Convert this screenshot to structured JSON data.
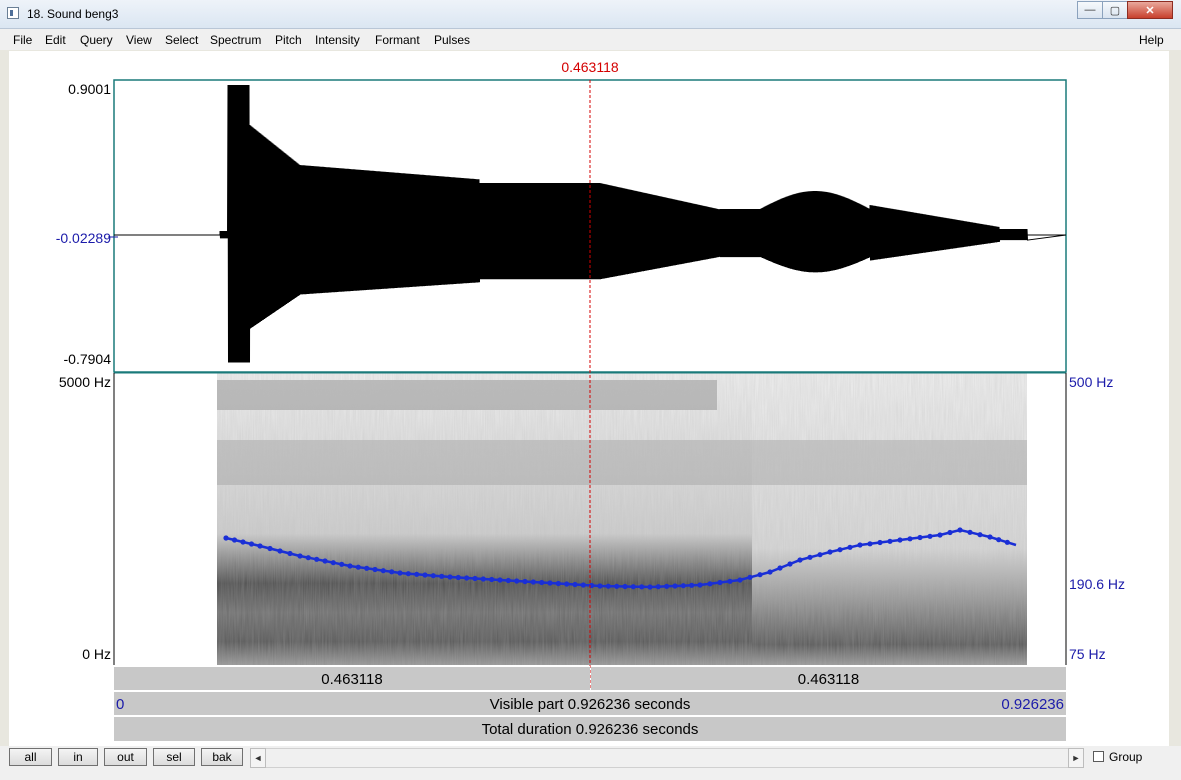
{
  "window": {
    "title": "18. Sound beng3"
  },
  "titlebar_buttons": {
    "minimize_icon": "minimize-icon",
    "maximize_icon": "maximize-icon",
    "close_icon": "close-icon",
    "minimize": "—",
    "maximize": "▢",
    "close": "✕"
  },
  "menu": {
    "items": [
      "File",
      "Edit",
      "Query",
      "View",
      "Select",
      "Spectrum",
      "Pitch",
      "Intensity",
      "Formant",
      "Pulses"
    ],
    "help": "Help"
  },
  "cursor": {
    "time": "0.463118"
  },
  "waveform": {
    "ymax": "0.9001",
    "ymid": "-0.02289",
    "ymin": "-0.7904"
  },
  "spectrogram": {
    "ymax": "5000 Hz",
    "ymin": "0 Hz"
  },
  "pitch_axis": {
    "top": "500 Hz",
    "mid": "190.6 Hz",
    "bottom": "75 Hz"
  },
  "time_bars": {
    "left_segment": "0.463118",
    "right_segment": "0.463118",
    "start": "0",
    "end": "0.926236",
    "visible_part": "Visible part 0.926236 seconds",
    "total_duration": "Total duration 0.926236 seconds"
  },
  "buttons": {
    "all": "all",
    "in": "in",
    "out": "out",
    "sel": "sel",
    "bak": "bak"
  },
  "scroll": {
    "left": "◄",
    "right": "►"
  },
  "group": {
    "label": "Group",
    "checked": false
  },
  "colors": {
    "cursor": "#d40000",
    "pitch": "#1a2fd6",
    "axis_blue": "#1b1baa"
  }
}
